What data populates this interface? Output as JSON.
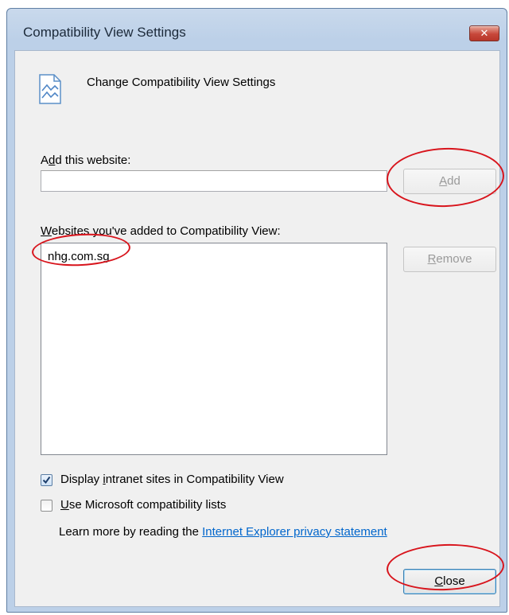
{
  "window": {
    "title": "Compatibility View Settings",
    "close_glyph": "✕"
  },
  "header": {
    "icon": "compatibility-view-icon",
    "text": "Change Compatibility View Settings"
  },
  "add_section": {
    "label_pre": "A",
    "label_u": "d",
    "label_post": "d this website:",
    "input_value": "",
    "add_button_u": "A",
    "add_button_post": "dd"
  },
  "list_section": {
    "label_u": "W",
    "label_post": "ebsites you've added to Compatibility View:",
    "items": [
      "nhg.com.sg"
    ],
    "remove_button_u": "R",
    "remove_button_post": "emove"
  },
  "options": {
    "intranet": {
      "pre": "Display ",
      "u": "i",
      "post": "ntranet sites in Compatibility View",
      "checked": true
    },
    "mslists": {
      "pre": "",
      "u": "U",
      "post": "se Microsoft compatibility lists",
      "checked": false
    }
  },
  "learn_more": {
    "text": "Learn more by reading the ",
    "link": "Internet Explorer privacy statement"
  },
  "footer": {
    "close_button_u": "C",
    "close_button_post": "lose"
  },
  "colors": {
    "annotation": "#d8141c",
    "link": "#0066cc"
  }
}
